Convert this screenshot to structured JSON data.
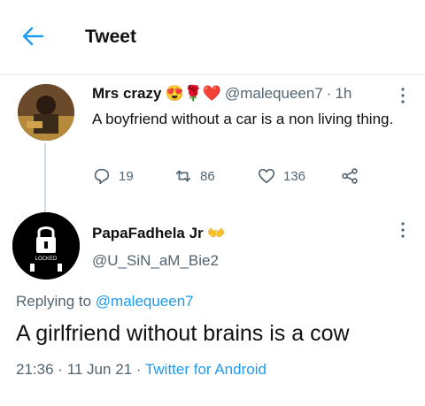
{
  "header": {
    "title": "Tweet"
  },
  "original_tweet": {
    "author_name": "Mrs crazy",
    "emojis": "😍🌹❤️",
    "handle": "@malequeen7",
    "separator": "·",
    "time": "1h",
    "text": "A boyfriend without a car is a non living thing.",
    "replies": "19",
    "retweets": "86",
    "likes": "136"
  },
  "reply_tweet": {
    "author_name": "PapaFadhela Jr",
    "emoji": "👐",
    "handle": "@U_SiN_aM_Bie2",
    "replying_prefix": "Replying to",
    "replying_to": "@malequeen7",
    "text": "A girlfriend without brains is a cow",
    "time": "21:36",
    "separator": "·",
    "date": "11 Jun 21",
    "separator2": "·",
    "source": "Twitter for Android",
    "avatar_lock_text": "LOCKED"
  },
  "colors": {
    "accent": "#1d9bf0",
    "muted": "#536471",
    "text": "#0f1419"
  },
  "icons": [
    "back-arrow-icon",
    "more-icon",
    "reply-icon",
    "retweet-icon",
    "like-icon",
    "share-icon",
    "lock-icon"
  ]
}
